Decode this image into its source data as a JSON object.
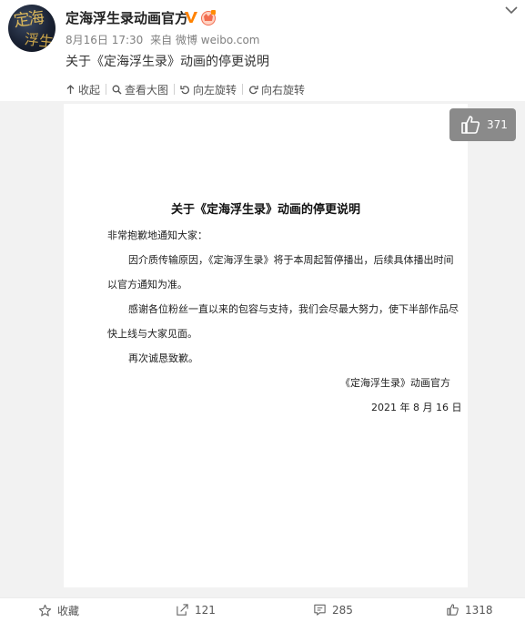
{
  "header": {
    "username": "定海浮生录动画官方",
    "date": "8月16日 17:30",
    "source": "来自 微博 weibo.com",
    "verified_color": "#ff8200"
  },
  "post": {
    "text": "关于《定海浮生录》动画的停更说明"
  },
  "toolbar": {
    "collapse": "收起",
    "view_large": "查看大图",
    "rotate_left": "向左旋转",
    "rotate_right": "向右旋转"
  },
  "image": {
    "like_count": "371",
    "title": "关于《定海浮生录》动画的停更说明",
    "greeting": "非常抱歉地通知大家：",
    "para1_line1": "因介质传输原因，《定海浮生录》将于本周起暂停播出，后续具体播出时间",
    "para1_line2": "以官方通知为准。",
    "para2_line1": "感谢各位粉丝一直以来的包容与支持，我们会尽最大努力，使下半部作品尽",
    "para2_line2": "快上线与大家见面。",
    "apology": "再次诚恳致歉。",
    "signature": "《定海浮生录》动画官方",
    "date": "2021 年 8 月 16 日"
  },
  "actions": {
    "favorite": "收藏",
    "repost": "121",
    "comment": "285",
    "like": "1318"
  },
  "icons": [
    "chevron-down-icon",
    "verified-icon",
    "vip-icon",
    "collapse-icon",
    "magnifier-icon",
    "rotate-left-icon",
    "rotate-right-icon",
    "thumbs-up-icon",
    "star-icon",
    "repost-icon",
    "comment-icon"
  ]
}
